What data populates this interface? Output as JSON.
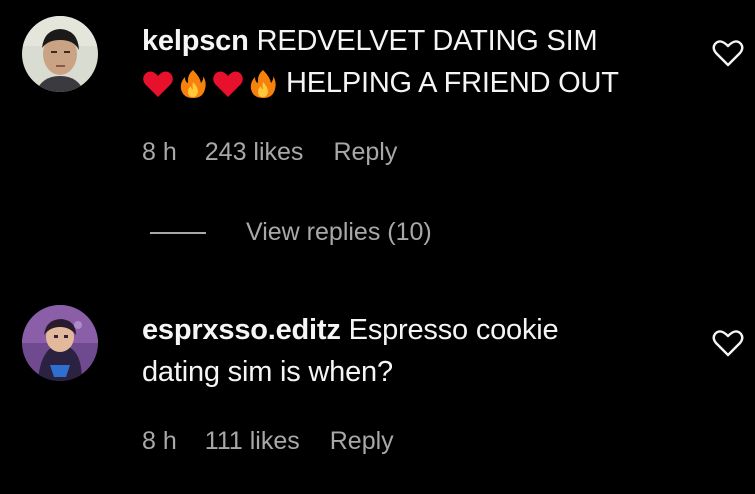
{
  "comments": [
    {
      "username": "kelpscn",
      "text_line1": "REDVELVET DATING SIM",
      "text_line2": "HELPING A FRIEND OUT",
      "emojis": [
        "red-heart",
        "fire",
        "red-heart",
        "fire"
      ],
      "time": "8 h",
      "likes": "243 likes",
      "reply_label": "Reply",
      "view_replies": "View replies (10)"
    },
    {
      "username": "esprxsso.editz",
      "text": "Espresso cookie",
      "text_line2": "dating sim is when?",
      "time": "8 h",
      "likes": "111 likes",
      "reply_label": "Reply"
    }
  ],
  "colors": {
    "background": "#000000",
    "primary_text": "#f5f5f5",
    "secondary_text": "#a8a8a8"
  }
}
